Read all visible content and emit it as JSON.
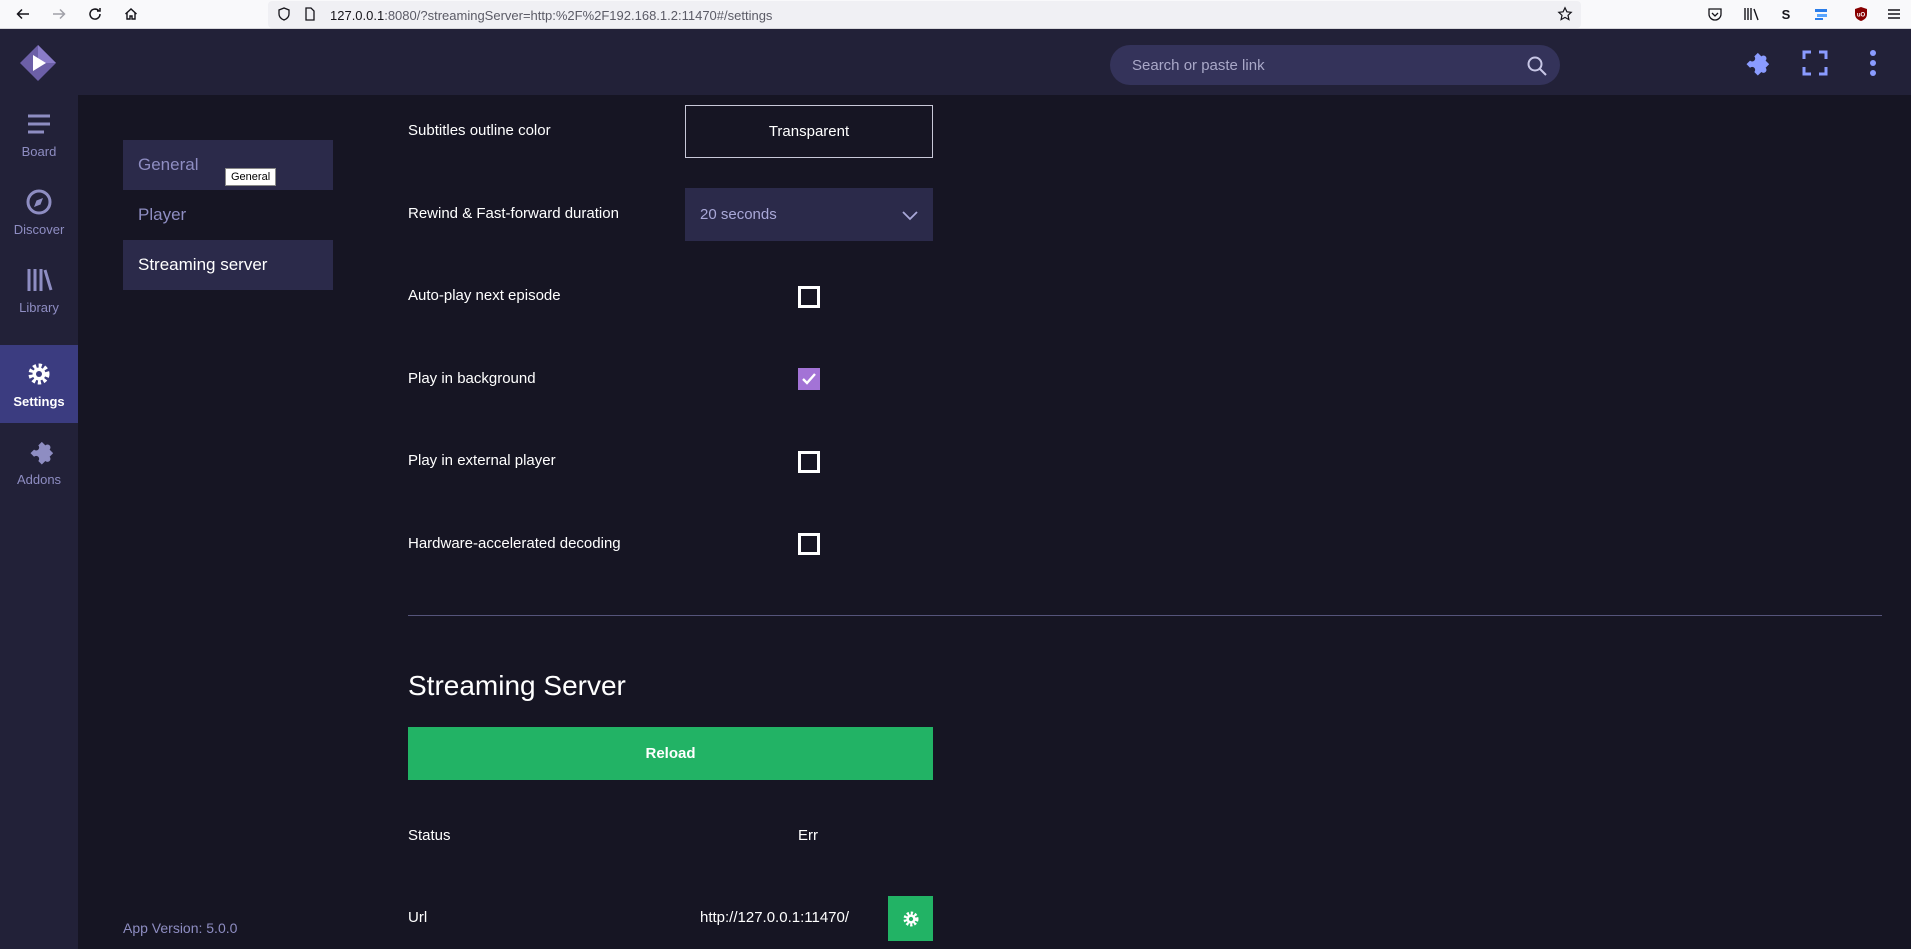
{
  "browser": {
    "url_host": "127.0.0.1",
    "url_rest": ":8080/?streamingServer=http:%2F%2F192.168.1.2:11470#/settings"
  },
  "header": {
    "search_placeholder": "Search or paste link"
  },
  "nav": {
    "items": [
      {
        "label": "Board",
        "icon": "menu-icon"
      },
      {
        "label": "Discover",
        "icon": "compass-icon"
      },
      {
        "label": "Library",
        "icon": "library-icon"
      },
      {
        "label": "Settings",
        "icon": "gear-icon",
        "active": true
      },
      {
        "label": "Addons",
        "icon": "puzzle-icon"
      }
    ]
  },
  "sections": {
    "items": [
      "General",
      "Player",
      "Streaming server"
    ],
    "tooltip": "General"
  },
  "app_version": "App Version: 5.0.0",
  "options": {
    "outline_color_label": "Subtitles outline color",
    "outline_color_value": "Transparent",
    "rewind_label": "Rewind & Fast-forward duration",
    "rewind_value": "20 seconds",
    "autoplay_label": "Auto-play next episode",
    "autoplay_checked": false,
    "background_label": "Play in background",
    "background_checked": true,
    "external_label": "Play in external player",
    "external_checked": false,
    "hwdec_label": "Hardware-accelerated decoding",
    "hwdec_checked": false
  },
  "streaming": {
    "title": "Streaming Server",
    "reload_label": "Reload",
    "status_label": "Status",
    "status_value": "Err",
    "url_label": "Url",
    "url_value": "http://127.0.0.1:11470/"
  },
  "colors": {
    "accent": "#3b3c80",
    "success": "#22b365",
    "checkbox": "#a373d6",
    "background": "#161523"
  }
}
